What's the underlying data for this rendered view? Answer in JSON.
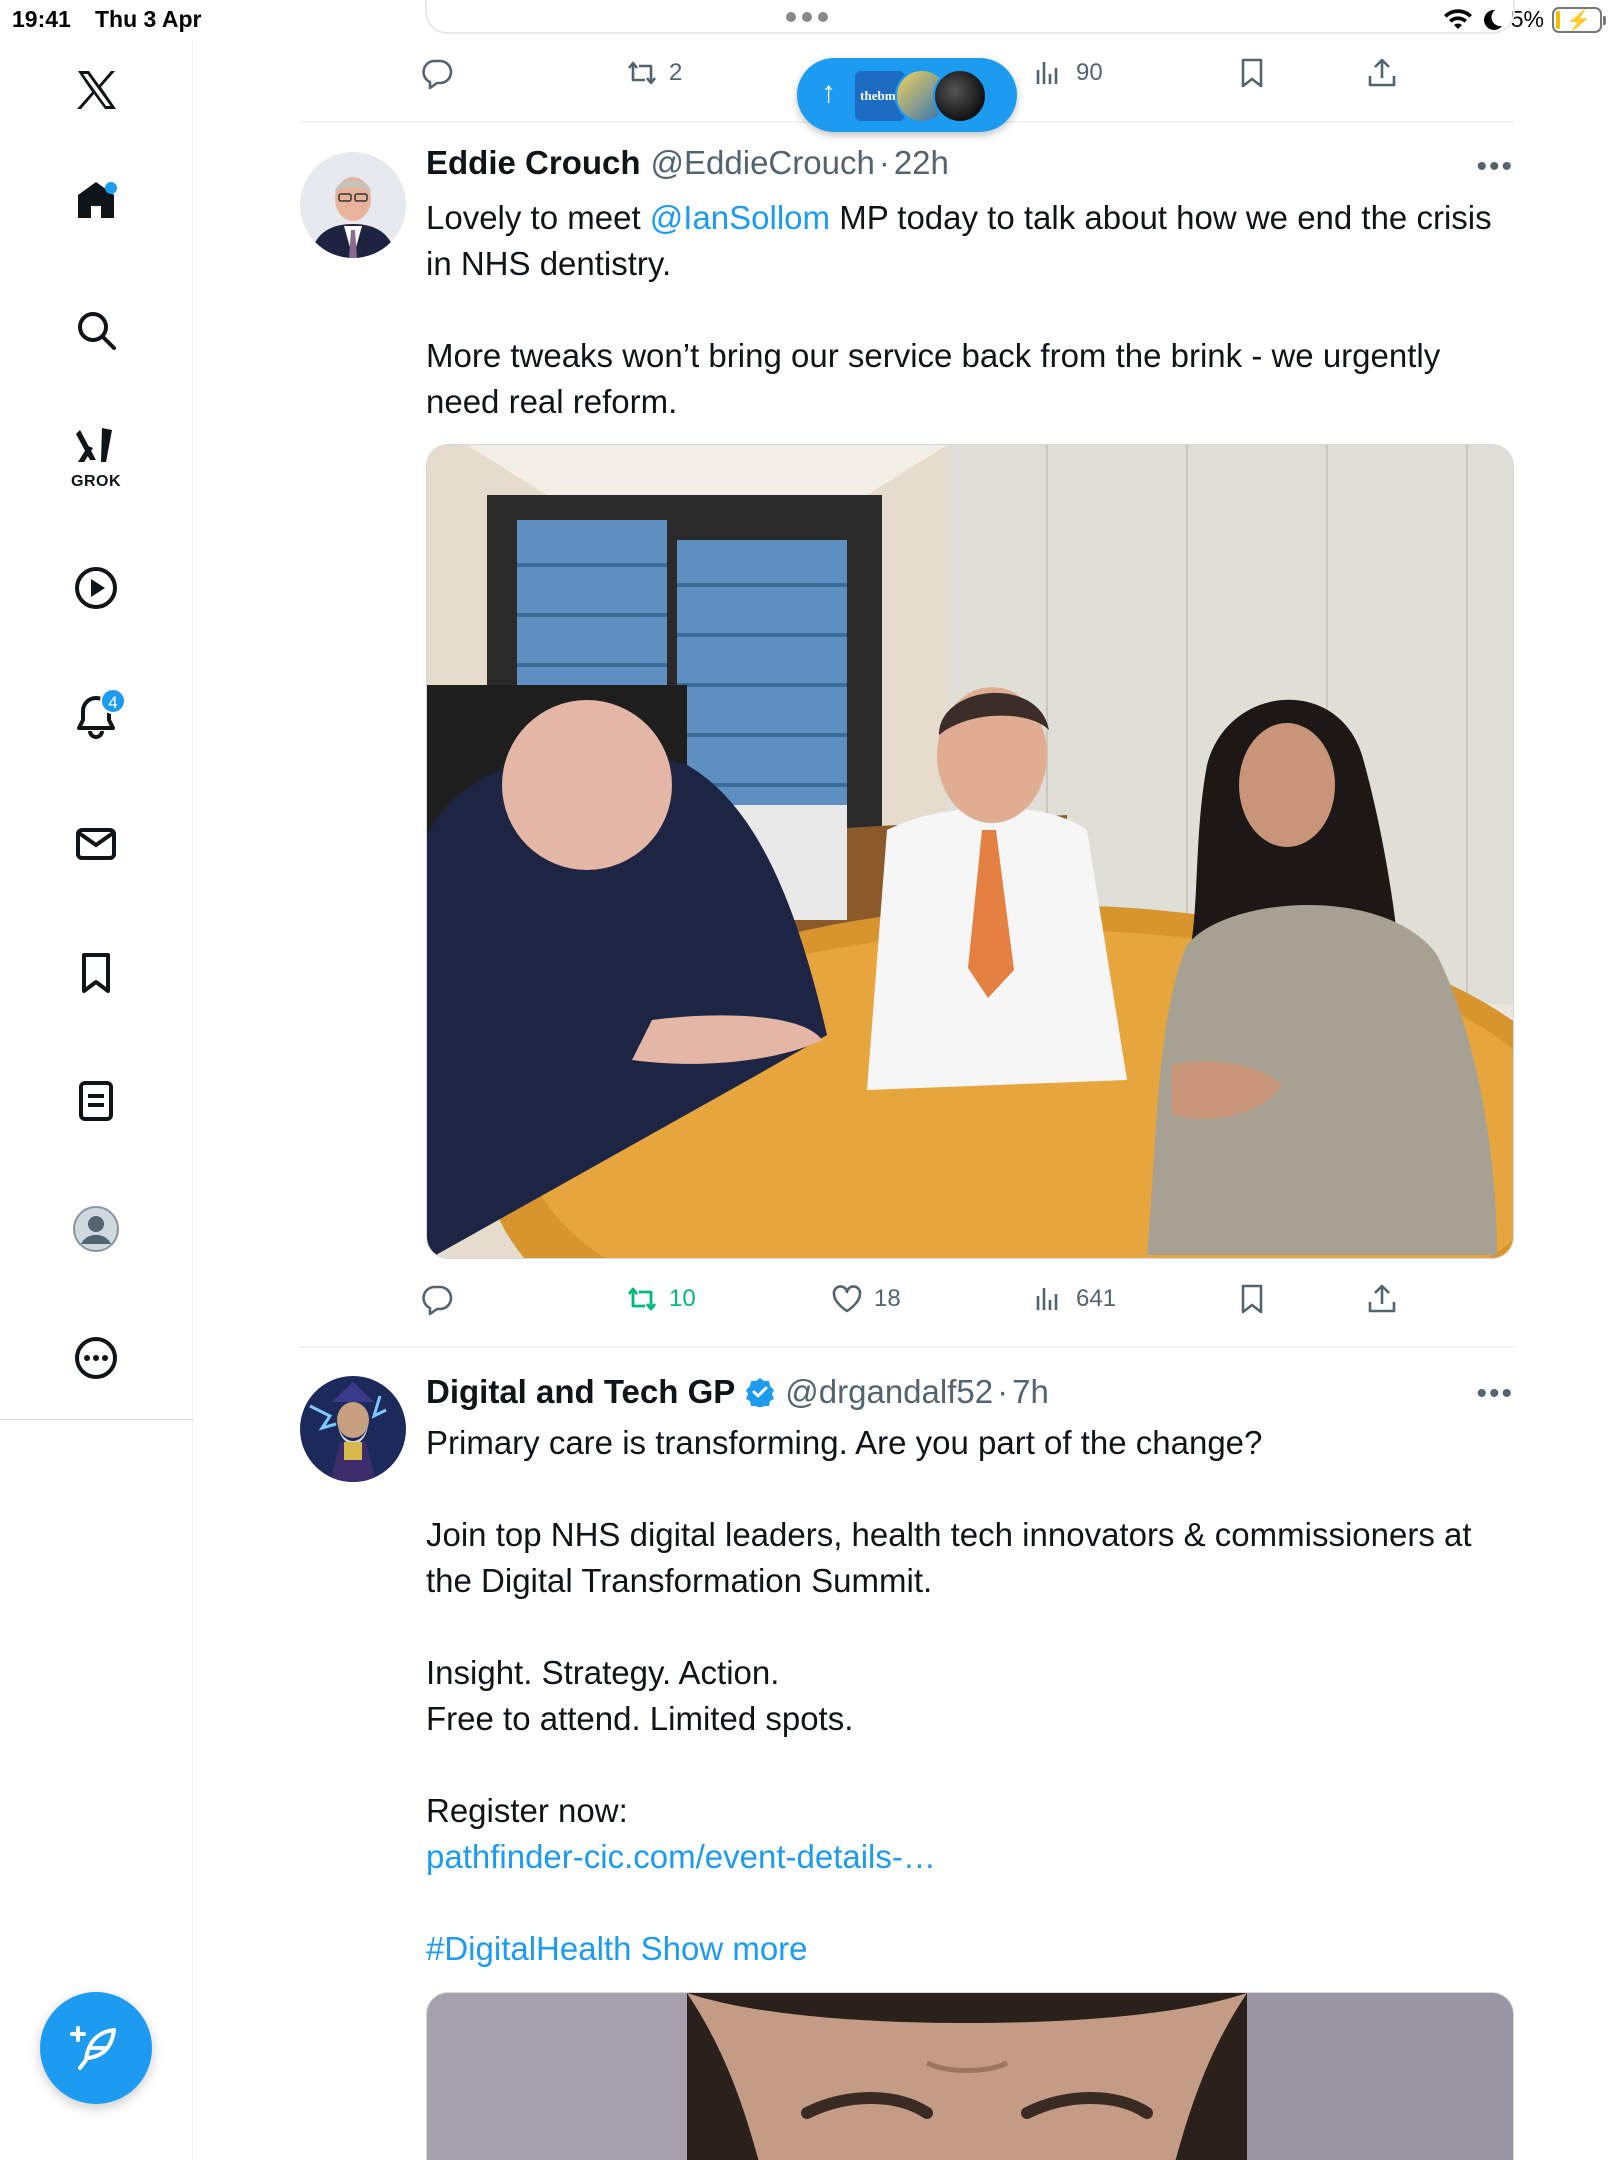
{
  "status_bar": {
    "time": "19:41",
    "date": "Thu 3 Apr",
    "battery": "5%"
  },
  "sidebar": {
    "grok_label": "GROK",
    "notifications_badge": "4"
  },
  "top_tweet": {
    "retweets": "2",
    "views": "90"
  },
  "new_posts_pill": {
    "bmj_label": "thebmj"
  },
  "tweets": [
    {
      "display_name": "Eddie Crouch",
      "handle": "@EddieCrouch",
      "separator": "·",
      "time": "22h",
      "text_prefix": "Lovely to meet ",
      "mention": "@IanSollom",
      "text_suffix": " MP today to talk about how we end the crisis in NHS dentistry.",
      "paragraph_2": "More tweaks won’t bring our service back from the brink - we urgently need real reform.",
      "retweets": "10",
      "likes": "18",
      "views": "641"
    },
    {
      "display_name": "Digital and Tech GP",
      "handle": "@drgandalf52",
      "separator": "·",
      "time": "7h",
      "line_1": "Primary care is transforming. Are you part of the change?",
      "line_2": "Join top NHS digital leaders, health tech innovators & commissioners at the Digital Transformation Summit.",
      "line_3": "Insight. Strategy. Action.",
      "line_4": "Free to attend. Limited spots.",
      "line_5": "Register now:",
      "link": "pathfinder-cic.com/event-details-…",
      "hashtag": "#DigitalHealth",
      "show_more": "Show more"
    }
  ],
  "colors": {
    "accent": "#1d9bf0",
    "retweet_active": "#00ba7c",
    "muted_text": "#536471"
  }
}
